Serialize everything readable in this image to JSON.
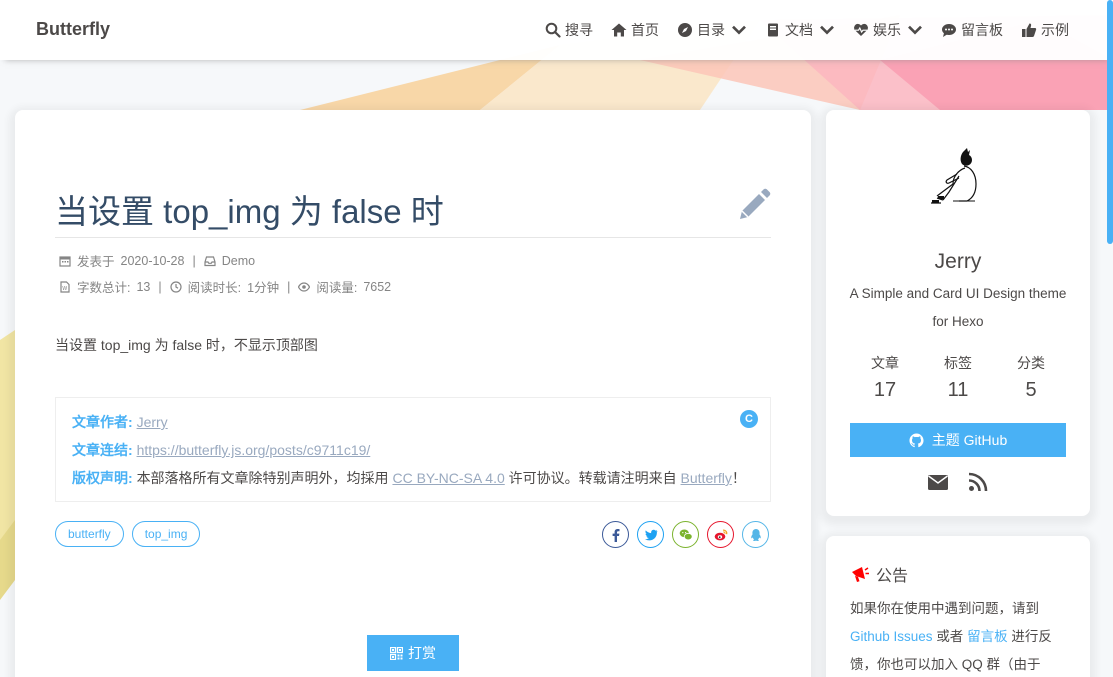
{
  "site": {
    "brand": "Butterfly"
  },
  "nav": {
    "items": [
      {
        "label": "搜寻",
        "icon": "search-icon"
      },
      {
        "label": "首页",
        "icon": "home-icon"
      },
      {
        "label": "目录",
        "icon": "compass-icon",
        "dropdown": true
      },
      {
        "label": "文档",
        "icon": "book-icon",
        "dropdown": true
      },
      {
        "label": "娱乐",
        "icon": "heartbeat-icon",
        "dropdown": true
      },
      {
        "label": "留言板",
        "icon": "comments-icon"
      },
      {
        "label": "示例",
        "icon": "thumbs-up-icon"
      }
    ]
  },
  "post": {
    "title": "当设置 top_img 为 false 时",
    "meta": {
      "posted_label": "发表于",
      "posted_date": "2020-10-28",
      "category": "Demo",
      "wordcount_label": "字数总计:",
      "wordcount": "13",
      "readtime_label": "阅读时长:",
      "readtime": "1分钟",
      "views_label": "阅读量:",
      "views": "7652",
      "separator": "|"
    },
    "content": "当设置 top_img 为 false 时，不显示顶部图",
    "copyright": {
      "author_key": "文章作者:",
      "author_value": "Jerry",
      "link_key": "文章连结:",
      "link_value": "https://butterfly.js.org/posts/c9711c19/",
      "license_key": "版权声明:",
      "license_prefix": "本部落格所有文章除特别声明外，均採用",
      "license_link": "CC BY-NC-SA 4.0",
      "license_middle": "许可协议。转载请注明来自",
      "license_site": "Butterfly",
      "license_suffix": "！",
      "badge": "C"
    },
    "tags": [
      "butterfly",
      "top_img"
    ],
    "share": [
      {
        "icon": "facebook-icon",
        "color": "#3b5998"
      },
      {
        "icon": "twitter-icon",
        "color": "#1da1f2"
      },
      {
        "icon": "wechat-icon",
        "color": "#7bb32e"
      },
      {
        "icon": "weibo-icon",
        "color": "#e6162d"
      },
      {
        "icon": "qq-icon",
        "color": "#56b6e7"
      }
    ],
    "reward_label": "打赏"
  },
  "author": {
    "name": "Jerry",
    "description": "A Simple and Card UI Design theme for Hexo",
    "stats": [
      {
        "label": "文章",
        "value": "17"
      },
      {
        "label": "标签",
        "value": "11"
      },
      {
        "label": "分类",
        "value": "5"
      }
    ],
    "github_label": "主题 GitHub"
  },
  "notice": {
    "title": "公告",
    "text_1": "如果你在使用中遇到问题，请到",
    "link_1": "Github Issues",
    "text_2": "或者",
    "link_2": "留言板",
    "text_3": "进行反馈，你也可以加入 QQ 群（由于"
  },
  "colors": {
    "accent": "#49b1f5",
    "title": "#344c67",
    "text": "#4c4948"
  }
}
